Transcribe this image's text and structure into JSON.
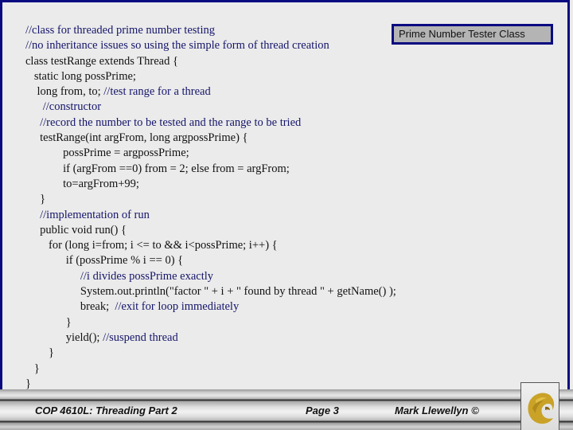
{
  "slide": {
    "title_box": "Prime Number Tester Class",
    "code_lines": [
      {
        "code": "",
        "comment": "//class for threaded prime number testing"
      },
      {
        "code": "",
        "comment": "//no inheritance issues so using the simple form of thread creation"
      },
      {
        "code": "class testRange extends Thread {",
        "comment": ""
      },
      {
        "code": "   static long possPrime;",
        "comment": ""
      },
      {
        "code": "    long from, to; ",
        "comment": "//test range for a thread"
      },
      {
        "code": "      ",
        "comment": "//constructor"
      },
      {
        "code": "     ",
        "comment": "//record the number to be tested and the range to be tried"
      },
      {
        "code": "     testRange(int argFrom, long argpossPrime) {",
        "comment": ""
      },
      {
        "code": "             possPrime = argpossPrime;",
        "comment": ""
      },
      {
        "code": "             if (argFrom ==0) from = 2; else from = argFrom;",
        "comment": ""
      },
      {
        "code": "             to=argFrom+99;",
        "comment": ""
      },
      {
        "code": "     }",
        "comment": ""
      },
      {
        "code": "     ",
        "comment": "//implementation of run"
      },
      {
        "code": "     public void run() {",
        "comment": ""
      },
      {
        "code": "        for (long i=from; i <= to && i<possPrime; i++) {",
        "comment": ""
      },
      {
        "code": "              if (possPrime % i == 0) {",
        "comment": ""
      },
      {
        "code": "                   ",
        "comment": "//i divides possPrime exactly"
      },
      {
        "code": "                   System.out.println(\"factor \" + i + \" found by thread \" + getName() );",
        "comment": ""
      },
      {
        "code": "                   break;  ",
        "comment": "//exit for loop immediately"
      },
      {
        "code": "              }",
        "comment": ""
      },
      {
        "code": "              yield(); ",
        "comment": "//suspend thread"
      },
      {
        "code": "        }",
        "comment": ""
      },
      {
        "code": "   }",
        "comment": ""
      },
      {
        "code": "}",
        "comment": ""
      }
    ]
  },
  "footer": {
    "course": "COP 4610L: Threading Part 2",
    "page": "Page 3",
    "author": "Mark Llewellyn ©",
    "logo_icon": "pegasus-logo-icon"
  },
  "colors": {
    "frame_border": "#0a0a80",
    "comment_text": "#15156b",
    "logo_gold": "#c9a227"
  }
}
